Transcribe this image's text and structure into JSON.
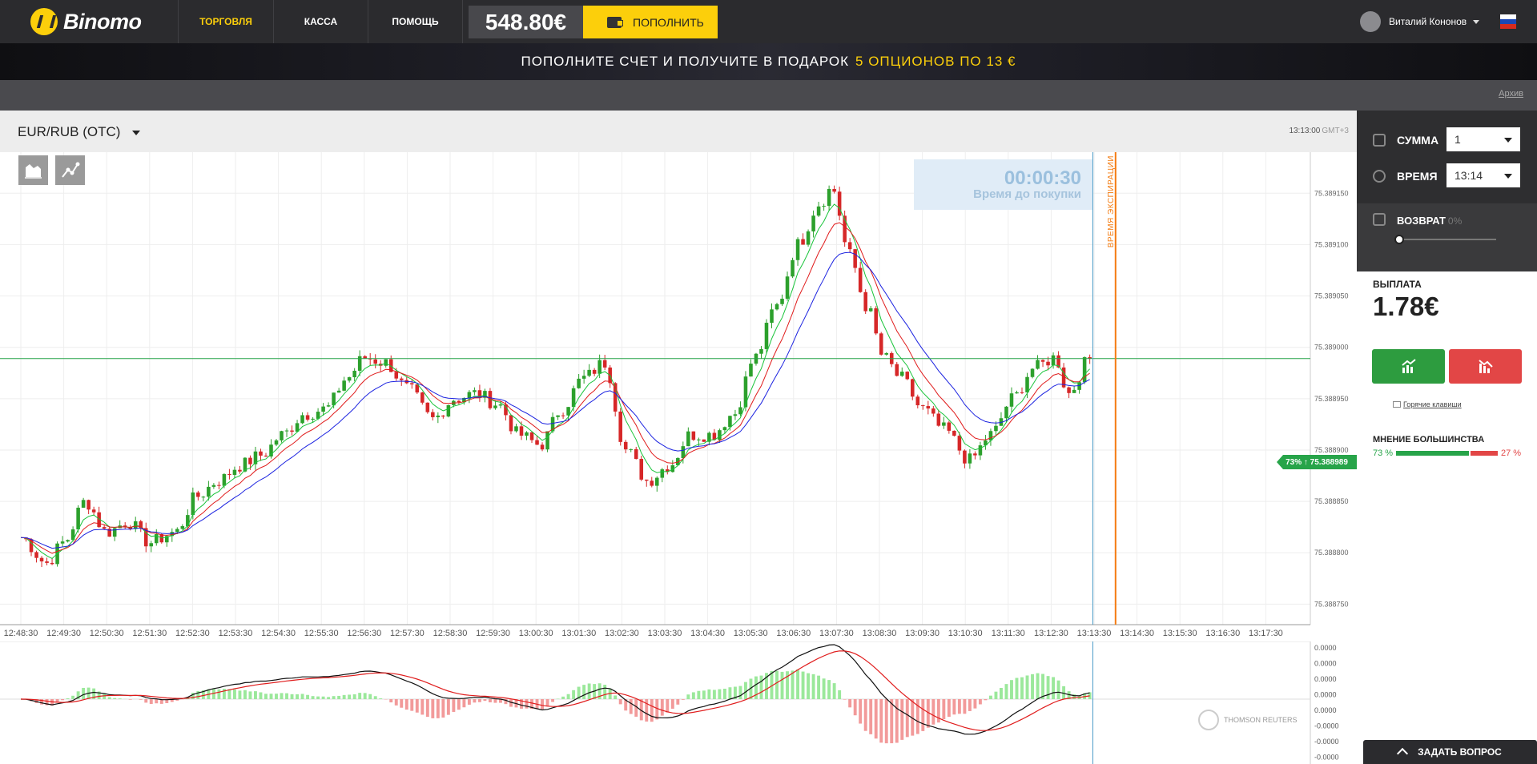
{
  "header": {
    "logo_text": "Binomo",
    "nav": [
      {
        "label": "ТОРГОВЛЯ",
        "active": true
      },
      {
        "label": "КАССА",
        "active": false
      },
      {
        "label": "ПОМОЩЬ",
        "active": false
      }
    ],
    "balance": "548.80€",
    "deposit_label": "ПОПОЛНИТЬ",
    "user_name": "Виталий Кононов",
    "accent_color": "#fccf0b"
  },
  "promo": {
    "text": "ПОПОЛНИТЕ СЧЕТ И ПОЛУЧИТЕ В ПОДАРОК",
    "highlight": "5 ОПЦИОНОВ ПО 13 €"
  },
  "archive_link": "Архив",
  "chart_header": {
    "asset": "EUR/RUB (OTC)",
    "server_time": "13:13:00",
    "timezone": "GMT+3"
  },
  "timer": {
    "value": "00:00:30",
    "label": "Время до покупки"
  },
  "expiry_label": "ВРЕМЯ ЭКСПИРАЦИИ",
  "current_price_tag": "73% ↑ 75.388989",
  "data_provider": "THOMSON REUTERS",
  "panel": {
    "amount_label": "СУММА",
    "amount_value": "1",
    "time_label": "ВРЕМЯ",
    "time_value": "13:14",
    "return_label": "ВОЗВРАТ",
    "return_value": "0%",
    "return_slider_level": 0,
    "payout_label": "ВЫПЛАТА",
    "payout_value": "1.78€",
    "hotkeys_label": "Горячие клавиши",
    "majority_label": "МНЕНИЕ БОЛЬШИНСТВА",
    "majority_up": "73 %",
    "majority_down": "27 %",
    "majority_up_fraction": 0.73
  },
  "ask_button": "ЗАДАТЬ ВОПРОС",
  "chart_data": [
    {
      "type": "candlestick",
      "y_ticks": [
        "75.389150",
        "75.389100",
        "75.389050",
        "75.389000",
        "75.388950",
        "75.388900",
        "75.388850",
        "75.388800",
        "75.388750"
      ],
      "x_ticks": [
        "12:48:30",
        "12:49:30",
        "12:50:30",
        "12:51:30",
        "12:52:30",
        "12:53:30",
        "12:54:30",
        "12:55:30",
        "12:56:30",
        "12:57:30",
        "12:58:30",
        "12:59:30",
        "13:00:30",
        "13:01:30",
        "13:02:30",
        "13:03:30",
        "13:04:30",
        "13:05:30",
        "13:06:30",
        "13:07:30",
        "13:08:30",
        "13:09:30",
        "13:10:30",
        "13:11:30",
        "13:12:30",
        "13:13:30",
        "13:14:30",
        "13:15:30",
        "13:16:30",
        "13:17:30"
      ],
      "ylim": [
        75.38873,
        75.38919
      ],
      "current_price": 75.388989,
      "anchors": [
        [
          0,
          75.388815
        ],
        [
          0.6,
          75.38879
        ],
        [
          1.0,
          75.38881
        ],
        [
          1.5,
          75.38885
        ],
        [
          2.0,
          75.38882
        ],
        [
          2.5,
          75.38883
        ],
        [
          3.0,
          75.38881
        ],
        [
          3.6,
          75.38882
        ],
        [
          4.1,
          75.388855
        ],
        [
          4.6,
          75.38887
        ],
        [
          5.1,
          75.388885
        ],
        [
          5.6,
          75.388895
        ],
        [
          6.1,
          75.388915
        ],
        [
          6.6,
          75.388935
        ],
        [
          7.1,
          75.38894
        ],
        [
          7.6,
          75.38897
        ],
        [
          8.0,
          75.38899
        ],
        [
          8.5,
          75.388985
        ],
        [
          9.0,
          75.38896
        ],
        [
          9.6,
          75.38893
        ],
        [
          10.1,
          75.38895
        ],
        [
          10.6,
          75.388955
        ],
        [
          11.1,
          75.388945
        ],
        [
          11.6,
          75.388915
        ],
        [
          12.1,
          75.388905
        ],
        [
          12.6,
          75.38894
        ],
        [
          13.1,
          75.38897
        ],
        [
          13.6,
          75.388985
        ],
        [
          14.1,
          75.3889
        ],
        [
          14.6,
          75.38887
        ],
        [
          15.1,
          75.388885
        ],
        [
          15.6,
          75.388915
        ],
        [
          16.1,
          75.388915
        ],
        [
          16.6,
          75.388935
        ],
        [
          17.1,
          75.38899
        ],
        [
          17.6,
          75.38904
        ],
        [
          18.1,
          75.3891
        ],
        [
          18.6,
          75.38914
        ],
        [
          18.9,
          75.389155
        ],
        [
          19.3,
          75.38909
        ],
        [
          19.7,
          75.38904
        ],
        [
          20.1,
          75.38899
        ],
        [
          20.5,
          75.38897
        ],
        [
          21.0,
          75.38894
        ],
        [
          21.5,
          75.38892
        ],
        [
          22.1,
          75.38889
        ],
        [
          22.6,
          75.388915
        ],
        [
          23.1,
          75.38895
        ],
        [
          23.6,
          75.38898
        ],
        [
          24.1,
          75.38899
        ],
        [
          24.4,
          75.388955
        ],
        [
          24.9,
          75.388989
        ]
      ]
    },
    {
      "type": "histogram",
      "y_ticks": [
        "0.0000",
        "0.0000",
        "0.0000",
        "0.0000",
        "0.0000",
        "-0.0000",
        "-0.0000",
        "-0.0000"
      ],
      "x_ticks": [],
      "ylim": [
        -1,
        1
      ]
    }
  ]
}
